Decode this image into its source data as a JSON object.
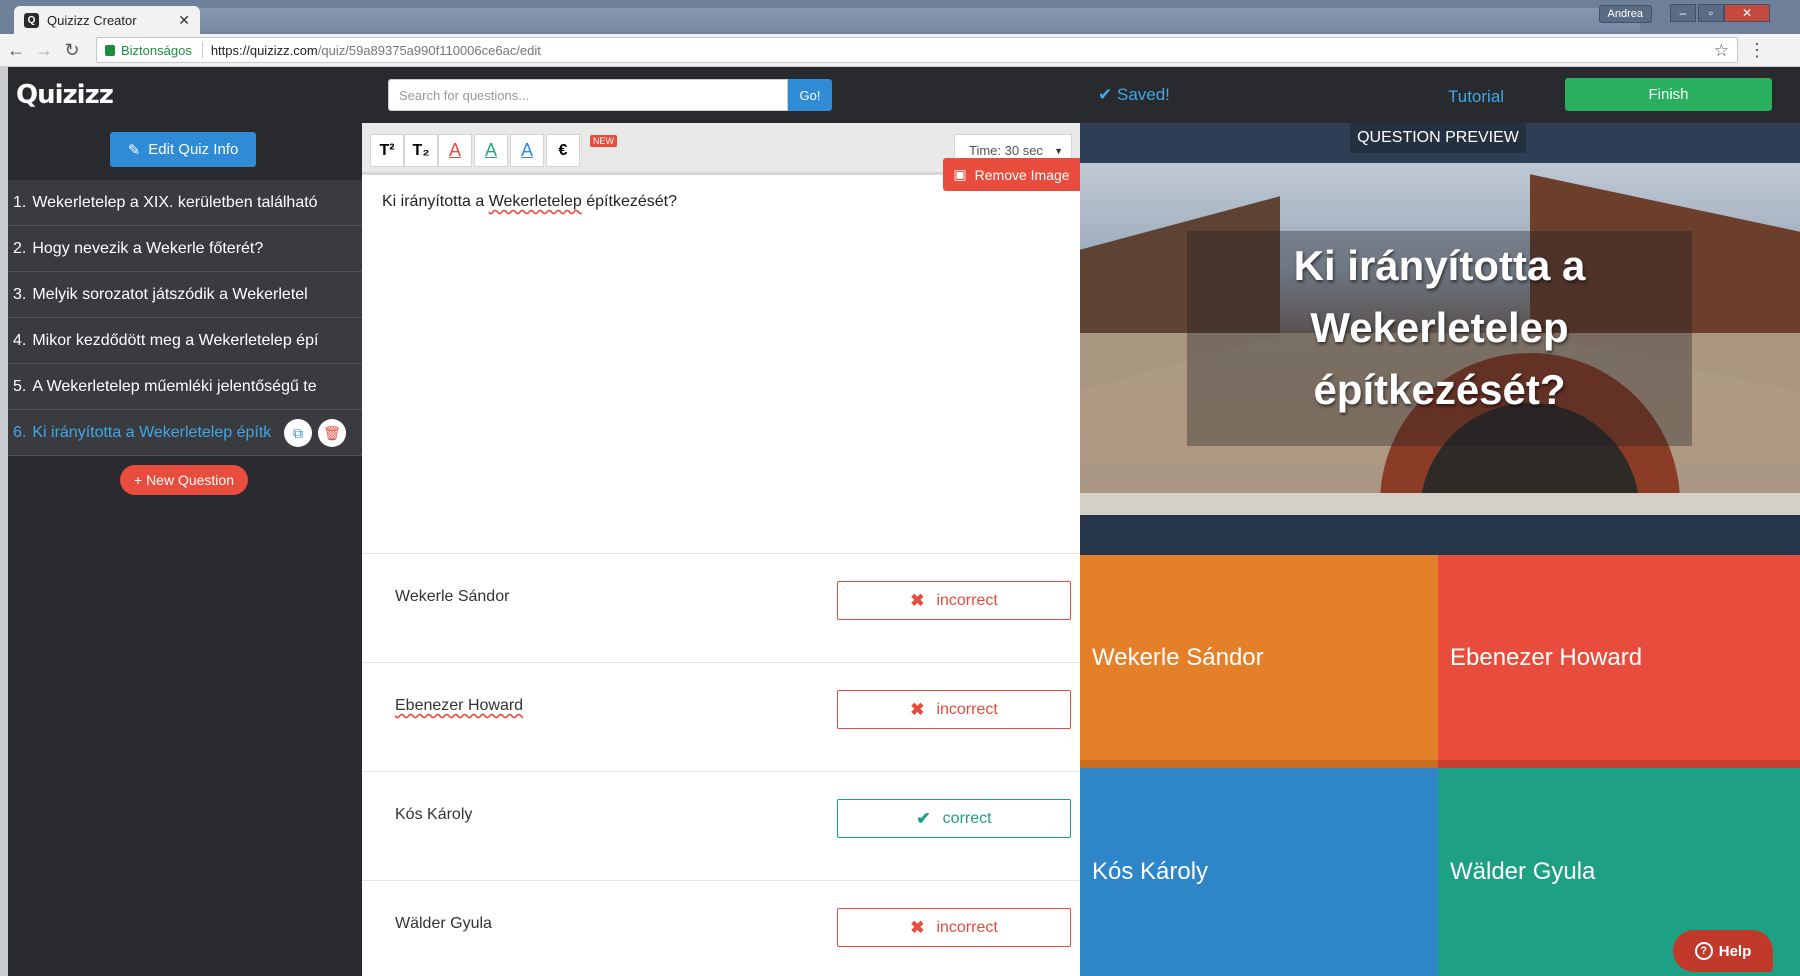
{
  "browser": {
    "tab_title": "Quizizz Creator",
    "tab_icon": "quizizz-favicon",
    "user_name": "Andrea",
    "secure_label": "Biztonságos",
    "url_host": "https://quizizz.com",
    "url_path": "/quiz/59a89375a990f110006ce6ac/edit"
  },
  "header": {
    "logo": "Quizizz",
    "search_placeholder": "Search for questions...",
    "go_label": "Go!",
    "saved_label": "Saved!",
    "tutorial_label": "Tutorial",
    "finish_label": "Finish"
  },
  "sidebar": {
    "edit_quiz_label": "Edit Quiz Info",
    "questions": [
      {
        "num": "1.",
        "text": "Wekerletelep a XIX. kerületben található"
      },
      {
        "num": "2.",
        "text": "Hogy nevezik a Wekerle főterét?"
      },
      {
        "num": "3.",
        "text": "Melyik sorozatot játszódik a Wekerletel"
      },
      {
        "num": "4.",
        "text": "Mikor kezdődött meg a Wekerletelep épí"
      },
      {
        "num": "5.",
        "text": "A Wekerletelep műemléki jelentőségű te"
      },
      {
        "num": "6.",
        "text": "Ki irányította a Wekerletelep építk"
      }
    ],
    "active_index": 5,
    "new_question_label": "New Question"
  },
  "toolbar": {
    "superscript": "T²",
    "subscript": "T₂",
    "color_a": "A",
    "euro": "€",
    "new_badge": "NEW",
    "time_label": "Time: 30 sec"
  },
  "question": {
    "text_prefix": "Ki irányította a ",
    "text_spell": "Wekerletelep",
    "text_suffix": " építkezését?",
    "remove_image_label": "Remove Image"
  },
  "answers": [
    {
      "text": "Wekerle Sándor",
      "status": "incorrect",
      "mark": "✖"
    },
    {
      "text": "Ebenezer Howard",
      "status": "incorrect",
      "mark": "✖"
    },
    {
      "text": "Kós Károly",
      "status": "correct",
      "mark": "✔"
    },
    {
      "text": "Wälder Gyula",
      "status": "incorrect",
      "mark": "✖"
    }
  ],
  "preview": {
    "label": "QUESTION PREVIEW",
    "question": "Ki irányította a Wekerletelep építkezését?",
    "options": [
      "Wekerle Sándor",
      "Ebenezer Howard",
      "Kós Károly",
      "Wälder Gyula"
    ],
    "colors": {
      "a": "#e5802a",
      "b": "#e74c3c",
      "c": "#2e86c7",
      "d": "#1ea085"
    },
    "help_label": "Help"
  }
}
